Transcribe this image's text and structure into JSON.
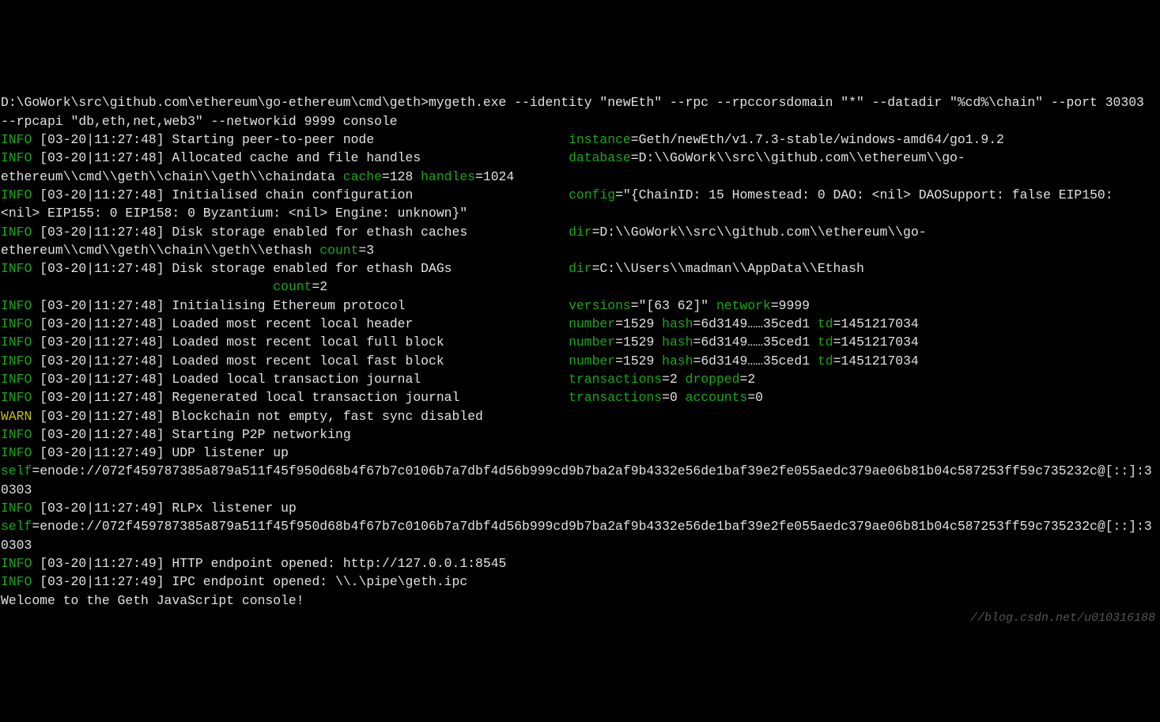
{
  "cmd_line": "D:\\GoWork\\src\\github.com\\ethereum\\go-ethereum\\cmd\\geth>mygeth.exe --identity \"newEth\" --rpc --rpccorsdomain \"*\" --datadir \"%cd%\\chain\" --port 30303 --rpcapi \"db,eth,net,web3\" --networkid 9999 console",
  "ts1": "[03-20|11:27:48] ",
  "ts2": "[03-20|11:27:49] ",
  "INFO": "INFO",
  "WARN": "WARN",
  "l1_msg": "Starting peer-to-peer node",
  "l1_k1": "instance",
  "l1_v1": "=Geth/newEth/v1.7.3-stable/windows-amd64/go1.9.2",
  "l2_msg": "Allocated cache and file handles",
  "l2_k1": "database",
  "l2_v1": "=D:\\\\GoWork\\\\src\\\\github.com\\\\ethereum\\\\go-ethereum\\\\cmd\\\\geth\\\\chain\\\\geth\\\\chaindata ",
  "l2_k2": "cache",
  "l2_v2": "=128 ",
  "l2_k3": "handles",
  "l2_v3": "=1024",
  "l3_msg": "Initialised chain configuration",
  "l3_k1": "config",
  "l3_v1": "=\"{ChainID: 15 Homestead: 0 DAO: <nil> DAOSupport: false EIP150: <nil> EIP155: 0 EIP158: 0 Byzantium: <nil> Engine: unknown}\"",
  "l4_msg": "Disk storage enabled for ethash caches",
  "l4_k1": "dir",
  "l4_v1": "=D:\\\\GoWork\\\\src\\\\github.com\\\\ethereum\\\\go-ethereum\\\\cmd\\\\geth\\\\chain\\\\geth\\\\ethash ",
  "l4_k2": "count",
  "l4_v2": "=3",
  "l5_msg": "Disk storage enabled for ethash DAGs",
  "l5_k1": "dir",
  "l5_v1": "=C:\\\\Users\\\\madman\\\\AppData\\\\Ethash",
  "l5_k2": "count",
  "l5_v2": "=2",
  "l6_msg": "Initialising Ethereum protocol",
  "l6_k1": "versions",
  "l6_v1": "=\"[63 62]\" ",
  "l6_k2": "network",
  "l6_v2": "=9999",
  "l7_msg": "Loaded most recent local header",
  "l8_msg": "Loaded most recent local full block",
  "l9_msg": "Loaded most recent local fast block",
  "blk_k1": "number",
  "blk_v1": "=1529 ",
  "blk_k2": "hash",
  "blk_v2": "=6d3149……35ced1 ",
  "blk_k3": "td",
  "blk_v3": "=1451217034",
  "l10_msg": "Loaded local transaction journal",
  "l10_k1": "transactions",
  "l10_v1": "=2 ",
  "l10_k2": "dropped",
  "l10_v2": "=2",
  "l11_msg": "Regenerated local transaction journal",
  "l11_k1": "transactions",
  "l11_v1": "=0 ",
  "l11_k2": "accounts",
  "l11_v2": "=0",
  "l12_msg": "Blockchain not empty, fast sync disabled",
  "l13_msg": "Starting P2P networking",
  "l14_msg": "UDP listener up",
  "l15_msg": "RLPx listener up",
  "self_k": "self",
  "self_v": "=enode://072f459787385a879a511f45f950d68b4f67b7c0106b7a7dbf4d56b999cd9b7ba2af9b4332e56de1baf39e2fe055aedc379ae06b81b04c587253ff59c735232c@[::]:30303",
  "l16_msg": "HTTP endpoint opened: http://127.0.0.1:8545",
  "l17_msg": "IPC endpoint opened: \\\\.\\pipe\\geth.ipc",
  "welcome": "Welcome to the Geth JavaScript console!",
  "pad_msgcol": 63,
  "watermark": "//blog.csdn.net/u010316188"
}
